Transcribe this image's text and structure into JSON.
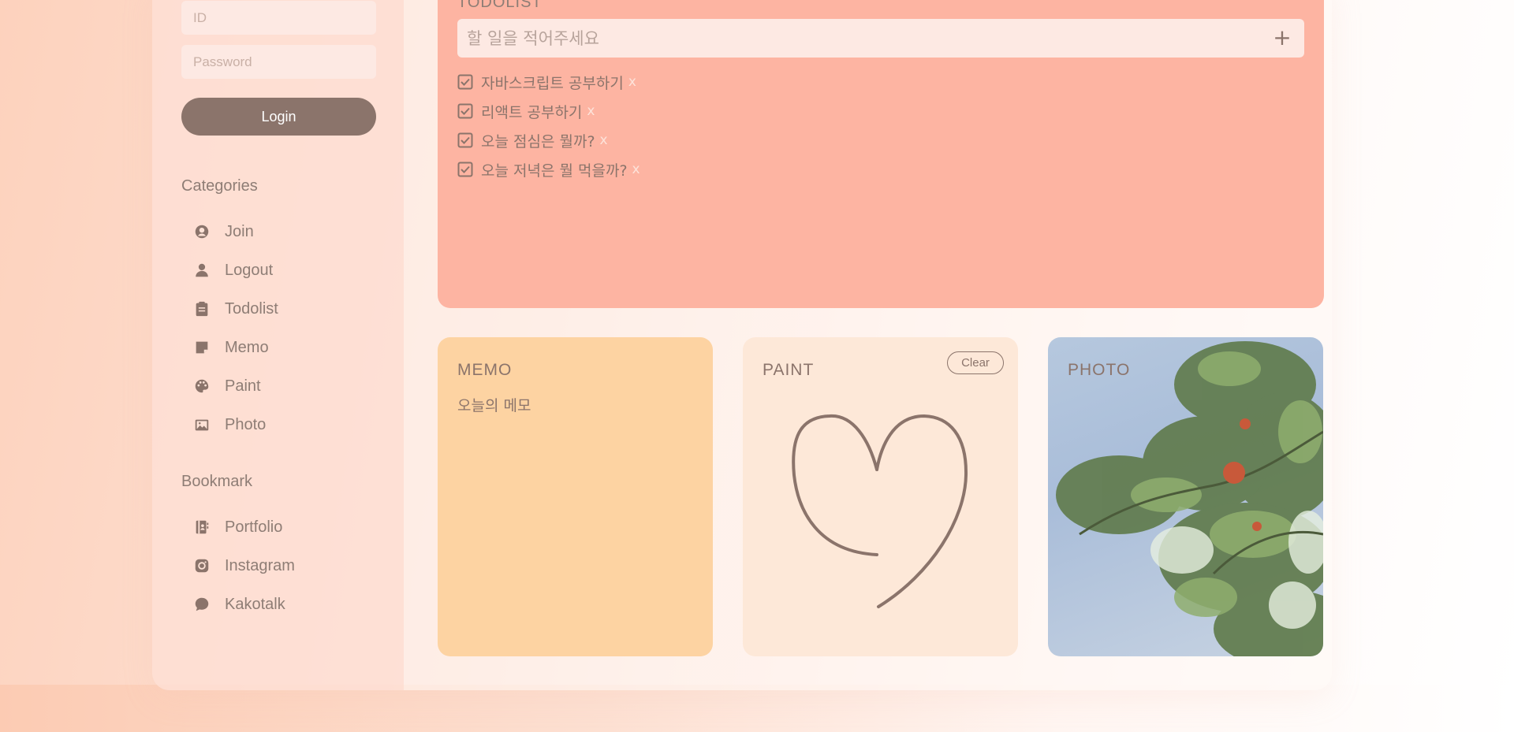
{
  "login": {
    "id_placeholder": "ID",
    "password_placeholder": "Password",
    "login_label": "Login"
  },
  "sidebar": {
    "categories_title": "Categories",
    "categories": [
      {
        "label": "Join",
        "icon": "user-circle-icon"
      },
      {
        "label": "Logout",
        "icon": "user-icon"
      },
      {
        "label": "Todolist",
        "icon": "clipboard-icon"
      },
      {
        "label": "Memo",
        "icon": "sticky-note-icon"
      },
      {
        "label": "Paint",
        "icon": "palette-icon"
      },
      {
        "label": "Photo",
        "icon": "image-icon"
      }
    ],
    "bookmark_title": "Bookmark",
    "bookmarks": [
      {
        "label": "Portfolio",
        "icon": "address-book-icon"
      },
      {
        "label": "Instagram",
        "icon": "instagram-icon"
      },
      {
        "label": "Kakotalk",
        "icon": "chat-bubble-icon"
      }
    ]
  },
  "todo": {
    "heading": "TODOLIST",
    "input_placeholder": "할 일을 적어주세요",
    "add_label": "+",
    "items": [
      {
        "text": "자바스크립트 공부하기",
        "delete": "x",
        "checked": true
      },
      {
        "text": "리액트 공부하기",
        "delete": "x",
        "checked": true
      },
      {
        "text": "오늘 점심은 뭘까?",
        "delete": "x",
        "checked": true
      },
      {
        "text": "오늘 저녁은 뭘 먹을까?",
        "delete": "x",
        "checked": true
      }
    ]
  },
  "memo": {
    "title": "MEMO",
    "text": "오늘의 메모"
  },
  "paint": {
    "title": "PAINT",
    "clear_label": "Clear",
    "stroke_color": "#8b746b"
  },
  "photo": {
    "title": "PHOTO"
  },
  "colors": {
    "accent": "#8b746b",
    "todo_bg": "#fdb4a2",
    "memo_bg": "#fdd3a2",
    "paint_bg": "#fde8d8"
  }
}
